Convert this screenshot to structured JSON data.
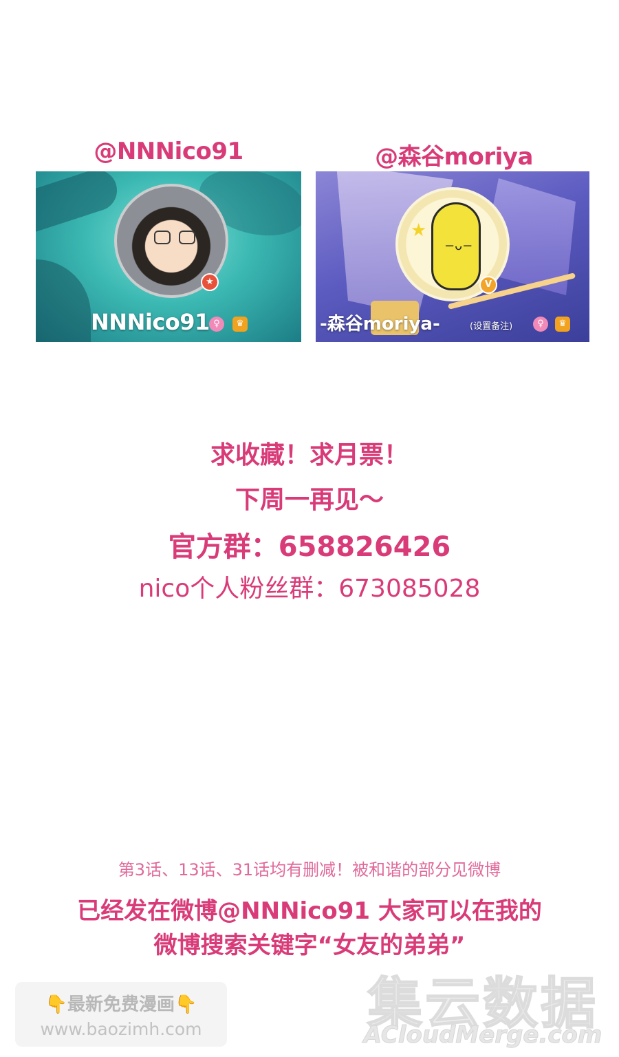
{
  "profiles": [
    {
      "handle": "@NNNico91",
      "name": "NNNico91",
      "badge_icon": "star-badge"
    },
    {
      "handle": "@森谷moriya",
      "name": "-森谷moriya-",
      "note": "(设置备注)",
      "badge_icon": "v-badge"
    }
  ],
  "announcement": {
    "line1": "求收藏！求月票！",
    "line2": "下周一再见～",
    "line3": "官方群：658826426",
    "line4": "nico个人粉丝群：673085028"
  },
  "notice": {
    "small": "第3话、13话、31话均有删减！被和谐的部分见微博",
    "line1": "已经发在微博@NNNico91  大家可以在我的",
    "line2": "微博搜索关键字“女友的弟弟”"
  },
  "promo": {
    "title": "最新免费漫画",
    "url": "www.baozimh.com"
  },
  "watermark": {
    "big": "集云数据",
    "small": "ACloudMerge.com"
  },
  "colors": {
    "accent": "#d83b78",
    "accent_light": "#e0699a"
  }
}
